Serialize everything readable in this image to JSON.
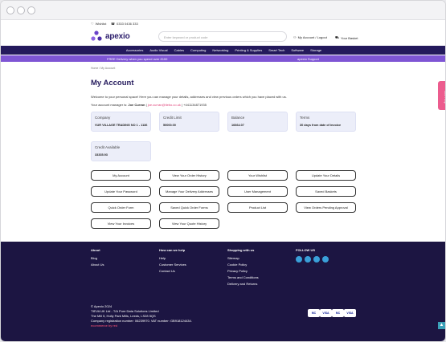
{
  "topbar": {
    "wishlist": "Wishlist",
    "phone": "0333 0436 333"
  },
  "header": {
    "logo": "apexio",
    "search_placeholder": "Enter keyword or product code",
    "account": "My Account / Logout",
    "basket": "Your Basket"
  },
  "nav": [
    "Accessories",
    "Audio Visual",
    "Cables",
    "Computing",
    "Networking",
    "Printing & Supplies",
    "Smart Tech",
    "Software",
    "Storage"
  ],
  "promo": {
    "delivery": "FREE Delivery when you spend over £100",
    "support": "apexio Support"
  },
  "breadcrumb": "Home / My Account",
  "page": {
    "title": "My Account",
    "intro": "Welcome to your personal space! Here you can manage your details, addresses and view previous orders which you have placed with us.",
    "manager_prefix": "Your account manager is:",
    "manager_name": "Joe Curran",
    "manager_email": "joe.curran@tiebo.co.uk",
    "manager_phone": "+441134871935"
  },
  "cards": [
    {
      "label": "Company",
      "value": "VUR VILLAGE TRADING NO 1 - 1136"
    },
    {
      "label": "Credit Limit",
      "value": "50000.00"
    },
    {
      "label": "Balance",
      "value": "16664.07"
    },
    {
      "label": "Terms",
      "value": "30 days from date of invoice"
    },
    {
      "label": "Credit Available",
      "value": "33335.93"
    }
  ],
  "buttons": [
    "My Account",
    "View Your Order History",
    "Your Wishlist",
    "Update Your Details",
    "Update Your Password",
    "Manage Your Delivery Addresses",
    "User Management",
    "Saved Baskets",
    "Quick Order Form",
    "Saved Quick Order Forms",
    "Product List",
    "View Orders Pending Approval",
    "View Your Invoices",
    "View Your Quote History"
  ],
  "footer": {
    "about": {
      "heading": "About",
      "links": [
        "Blog",
        "About Us"
      ]
    },
    "help": {
      "heading": "How can we help",
      "links": [
        "Help",
        "Customer Services",
        "Contact Us"
      ]
    },
    "shopping": {
      "heading": "Shopping with us",
      "links": [
        "Sitemap",
        "Cookie Policy",
        "Privacy Policy",
        "Terms and Conditions",
        "Delivery and Returns"
      ]
    },
    "follow": {
      "heading": "FOLLOW US"
    },
    "legal": [
      "© Apexio 2024",
      "TIEVA UK Ltd - T/A Pure Data Solutions Limited",
      "The Mill 5, Holly Park Mills, Leeds, LS28 5QS",
      "Company registration number: 06239970. VAT number: GB918124434."
    ],
    "ecommerce": "ecommerce by red",
    "payments": [
      "MC",
      "VISA",
      "MC",
      "VISA"
    ]
  },
  "side_tab": "Live Help",
  "colors": {
    "brand": "#241a5c",
    "promo": "#7e55d4",
    "accent": "#ec5c8e",
    "card": "#eceef9"
  }
}
